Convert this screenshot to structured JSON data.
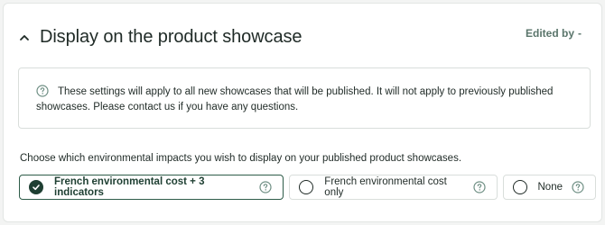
{
  "section": {
    "title": "Display on the product showcase",
    "edited_by_label": "Edited by",
    "edited_by_value": "-"
  },
  "info": {
    "text": "These settings will apply to all new showcases that will be published. It will not apply to previously published showcases. Please contact us if you have any questions."
  },
  "prompt": "Choose which environmental impacts you wish to display on your published product showcases.",
  "options": [
    {
      "label": "French environmental cost + 3 indicators",
      "selected": true
    },
    {
      "label": "French environmental cost only",
      "selected": false
    },
    {
      "label": "None",
      "selected": false
    }
  ],
  "colors": {
    "accent": "#1e3f32",
    "help_icon": "#6f8f84",
    "muted_text": "#5a756b"
  },
  "icons": {
    "collapse": "chevron-up-icon",
    "info": "question-circle-icon",
    "selected": "check-icon",
    "help": "question-circle-icon"
  }
}
